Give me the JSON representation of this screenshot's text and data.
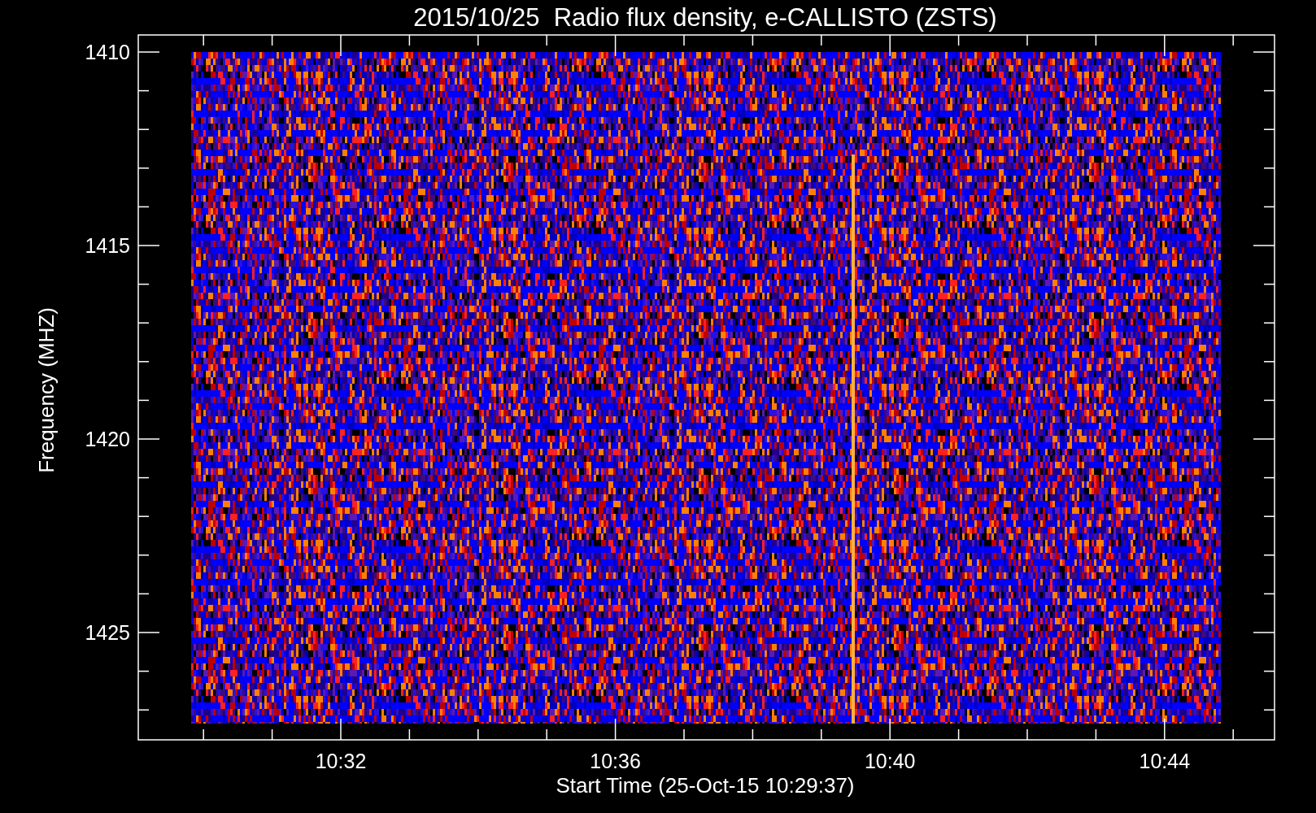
{
  "title": "2015/10/25  Radio flux density, e-CALLISTO (ZSTS)",
  "y_axis": {
    "label": "Frequency (MHZ)",
    "ticks": [
      "1410",
      "1415",
      "1420",
      "1425"
    ]
  },
  "x_axis": {
    "label": "Start Time (25-Oct-15 10:29:37)",
    "ticks": [
      "10:32",
      "10:36",
      "10:40",
      "10:44"
    ]
  }
}
